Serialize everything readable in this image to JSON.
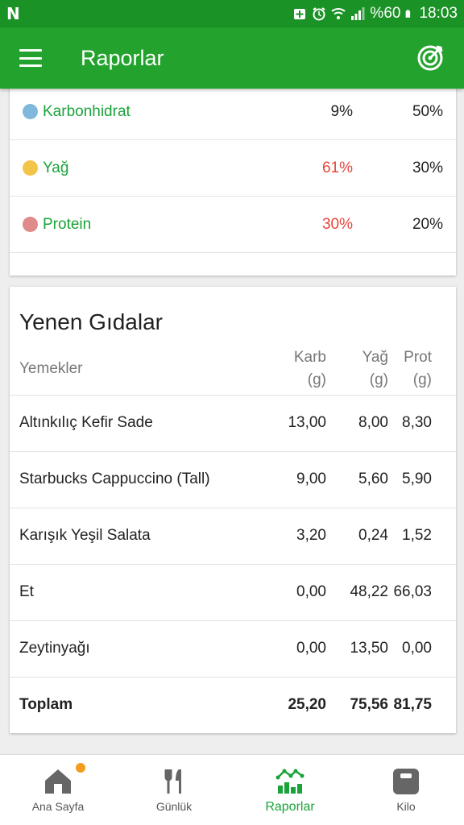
{
  "status_bar": {
    "logo": "N",
    "battery_text": "%60",
    "time": "18:03"
  },
  "app_bar": {
    "title": "Raporlar",
    "menu_icon": "hamburger-menu-icon",
    "action_icon": "target-icon"
  },
  "macros": [
    {
      "name": "Karbonhidrat",
      "actual": "9%",
      "target": "50%",
      "color": "#7fb8dc",
      "over": false
    },
    {
      "name": "Yağ",
      "actual": "61%",
      "target": "30%",
      "color": "#f2c54a",
      "over": true
    },
    {
      "name": "Protein",
      "actual": "30%",
      "target": "20%",
      "color": "#e08a8a",
      "over": true
    }
  ],
  "foods": {
    "title": "Yenen Gıdalar",
    "headers": {
      "name": "Yemekler",
      "karb_line1": "Karb",
      "karb_line2": "(g)",
      "yag_line1": "Yağ",
      "yag_line2": "(g)",
      "prot_line1": "Prot",
      "prot_line2": "(g)"
    },
    "rows": [
      {
        "name": "Altınkılıç Kefir Sade",
        "karb": "13,00",
        "yag": "8,00",
        "prot": "8,30"
      },
      {
        "name": "Starbucks Cappuccino (Tall)",
        "karb": "9,00",
        "yag": "5,60",
        "prot": "5,90"
      },
      {
        "name": "Karışık Yeşil Salata",
        "karb": "3,20",
        "yag": "0,24",
        "prot": "1,52"
      },
      {
        "name": "Et",
        "karb": "0,00",
        "yag": "48,22",
        "prot": "66,03"
      },
      {
        "name": "Zeytinyağı",
        "karb": "0,00",
        "yag": "13,50",
        "prot": "0,00"
      }
    ],
    "total": {
      "name": "Toplam",
      "karb": "25,20",
      "yag": "75,56",
      "prot": "81,75"
    }
  },
  "bottom_nav": [
    {
      "label": "Ana Sayfa",
      "icon": "home-icon",
      "active": false,
      "badge": true
    },
    {
      "label": "Günlük",
      "icon": "fork-knife-icon",
      "active": false,
      "badge": false
    },
    {
      "label": "Raporlar",
      "icon": "bar-chart-icon",
      "active": true,
      "badge": false
    },
    {
      "label": "Kilo",
      "icon": "scale-icon",
      "active": false,
      "badge": false
    }
  ],
  "colors": {
    "primary": "#23a32d",
    "status_bar": "#1a9226",
    "accent_green": "#1aa33a",
    "over_red": "#e8453c",
    "badge_orange": "#f39c1f"
  }
}
